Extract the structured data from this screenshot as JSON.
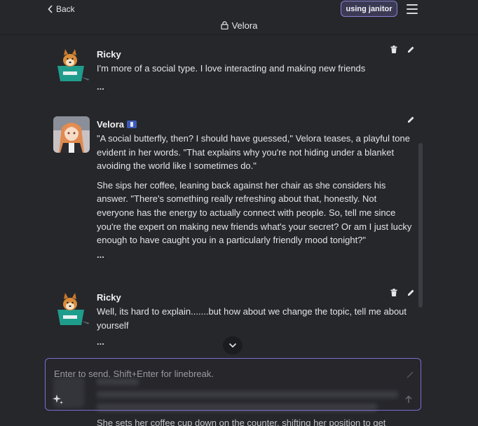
{
  "header": {
    "back_label": "Back",
    "title": "Velora",
    "badge_label": "using janitor"
  },
  "messages": [
    {
      "author": "Ricky",
      "paragraphs": [
        "I'm more of a social type. I love interacting and making new friends"
      ],
      "more": "..."
    },
    {
      "author": "Velora",
      "paragraphs": [
        "\"A social butterfly, then? I should have guessed,\" Velora teases, a playful tone evident in her words. \"That explains why you're not hiding under a blanket avoiding the world like I sometimes do.\"",
        "She sips her coffee, leaning back against her chair as she considers his answer. \"There's something really refreshing about that, honestly. Not everyone has the energy to actually connect with people. So, tell me since you're the expert on making new friends what's your secret? Or am I just lucky enough to have caught you in a particularly friendly mood tonight?\""
      ],
      "more": "..."
    },
    {
      "author": "Ricky",
      "paragraphs": [
        "Well, its hard to explain.......but how about we change the topic, tell me about yourself"
      ],
      "more": "..."
    }
  ],
  "composer": {
    "placeholder": "Enter to send. Shift+Enter for linebreak."
  },
  "below_fold_text": "She sets her coffee cup down on the counter, shifting her position to get"
}
